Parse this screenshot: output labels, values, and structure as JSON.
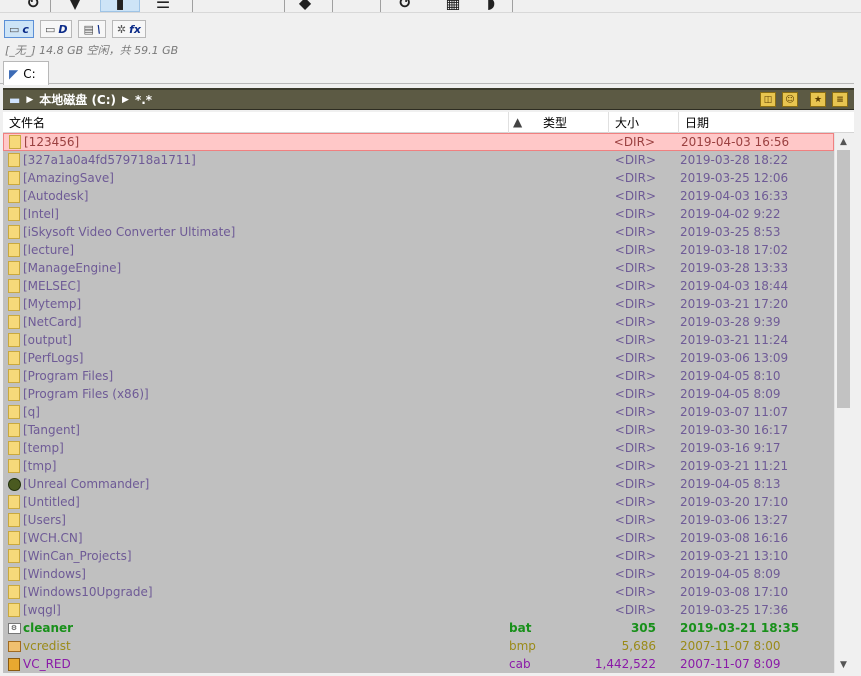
{
  "toolbar": {
    "buttons": [
      "rotate-icon",
      "arrow-icon",
      "panel-icon",
      "list-icon",
      "cube-icon",
      "undo-icon",
      "grid-icon",
      "drive-icon"
    ]
  },
  "drives": [
    {
      "letter": "c",
      "selected": true
    },
    {
      "letter": "D",
      "selected": false
    },
    {
      "letter": "\\",
      "selected": false
    },
    {
      "letter": "fx",
      "selected": false
    }
  ],
  "free_space_text": "[_无_] 14.8 GB 空闲，共 59.1 GB",
  "tab": {
    "label": "C:"
  },
  "path": {
    "drive_label": "本地磁盘 (C:)",
    "filter": "*.*"
  },
  "headers": {
    "name": "文件名",
    "type": "类型",
    "size": "大小",
    "date": "日期"
  },
  "rows": [
    {
      "name": "[123456]",
      "type": "",
      "size": "<DIR>",
      "date": "2019-04-03 16:56",
      "kind": "sel"
    },
    {
      "name": "[327a1a0a4fd579718a1711]",
      "type": "",
      "size": "<DIR>",
      "date": "2019-03-28 18:22",
      "kind": "dir"
    },
    {
      "name": "[AmazingSave]",
      "type": "",
      "size": "<DIR>",
      "date": "2019-03-25 12:06",
      "kind": "dir"
    },
    {
      "name": "[Autodesk]",
      "type": "",
      "size": "<DIR>",
      "date": "2019-04-03 16:33",
      "kind": "dir"
    },
    {
      "name": "[Intel]",
      "type": "",
      "size": "<DIR>",
      "date": "2019-04-02 9:22",
      "kind": "dir"
    },
    {
      "name": "[iSkysoft Video Converter Ultimate]",
      "type": "",
      "size": "<DIR>",
      "date": "2019-03-25 8:53",
      "kind": "dir"
    },
    {
      "name": "[lecture]",
      "type": "",
      "size": "<DIR>",
      "date": "2019-03-18 17:02",
      "kind": "dir"
    },
    {
      "name": "[ManageEngine]",
      "type": "",
      "size": "<DIR>",
      "date": "2019-03-28 13:33",
      "kind": "dir"
    },
    {
      "name": "[MELSEC]",
      "type": "",
      "size": "<DIR>",
      "date": "2019-04-03 18:44",
      "kind": "dir"
    },
    {
      "name": "[Mytemp]",
      "type": "",
      "size": "<DIR>",
      "date": "2019-03-21 17:20",
      "kind": "dir"
    },
    {
      "name": "[NetCard]",
      "type": "",
      "size": "<DIR>",
      "date": "2019-03-28 9:39",
      "kind": "dir"
    },
    {
      "name": "[output]",
      "type": "",
      "size": "<DIR>",
      "date": "2019-03-21 11:24",
      "kind": "dir"
    },
    {
      "name": "[PerfLogs]",
      "type": "",
      "size": "<DIR>",
      "date": "2019-03-06 13:09",
      "kind": "dir"
    },
    {
      "name": "[Program Files]",
      "type": "",
      "size": "<DIR>",
      "date": "2019-04-05 8:10",
      "kind": "dir"
    },
    {
      "name": "[Program Files (x86)]",
      "type": "",
      "size": "<DIR>",
      "date": "2019-04-05 8:09",
      "kind": "dir"
    },
    {
      "name": "[q]",
      "type": "",
      "size": "<DIR>",
      "date": "2019-03-07 11:07",
      "kind": "dir"
    },
    {
      "name": "[Tangent]",
      "type": "",
      "size": "<DIR>",
      "date": "2019-03-30 16:17",
      "kind": "dir"
    },
    {
      "name": "[temp]",
      "type": "",
      "size": "<DIR>",
      "date": "2019-03-16 9:17",
      "kind": "dir"
    },
    {
      "name": "[tmp]",
      "type": "",
      "size": "<DIR>",
      "date": "2019-03-21 11:21",
      "kind": "dir"
    },
    {
      "name": "[Unreal Commander]",
      "type": "",
      "size": "<DIR>",
      "date": "2019-04-05 8:13",
      "kind": "uc"
    },
    {
      "name": "[Untitled]",
      "type": "",
      "size": "<DIR>",
      "date": "2019-03-20 17:10",
      "kind": "dir"
    },
    {
      "name": "[Users]",
      "type": "",
      "size": "<DIR>",
      "date": "2019-03-06 13:27",
      "kind": "dir"
    },
    {
      "name": "[WCH.CN]",
      "type": "",
      "size": "<DIR>",
      "date": "2019-03-08 16:16",
      "kind": "dir"
    },
    {
      "name": "[WinCan_Projects]",
      "type": "",
      "size": "<DIR>",
      "date": "2019-03-21 13:10",
      "kind": "dir"
    },
    {
      "name": "[Windows]",
      "type": "",
      "size": "<DIR>",
      "date": "2019-04-05 8:09",
      "kind": "dir"
    },
    {
      "name": "[Windows10Upgrade]",
      "type": "",
      "size": "<DIR>",
      "date": "2019-03-08 17:10",
      "kind": "dir"
    },
    {
      "name": "[wqgl]",
      "type": "",
      "size": "<DIR>",
      "date": "2019-03-25 17:36",
      "kind": "dir"
    },
    {
      "name": "cleaner",
      "type": "bat",
      "size": "305",
      "date": "2019-03-21 18:35",
      "kind": "bat"
    },
    {
      "name": "vcredist",
      "type": "bmp",
      "size": "5,686",
      "date": "2007-11-07 8:00",
      "kind": "bmp"
    },
    {
      "name": "VC_RED",
      "type": "cab",
      "size": "1,442,522",
      "date": "2007-11-07 8:09",
      "kind": "cab"
    }
  ],
  "colors": {
    "list_background": "#c0c0c0",
    "selected_row": "#ffc8c8",
    "directory_text": "#6e5a96",
    "path_bar": "#5c5a44"
  }
}
